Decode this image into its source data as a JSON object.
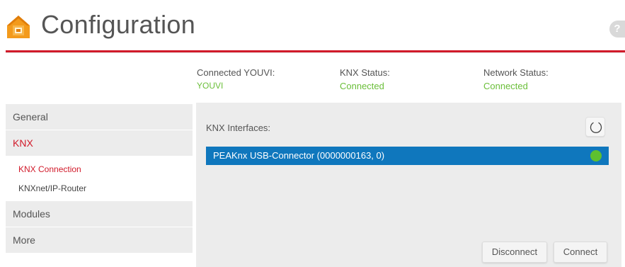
{
  "header": {
    "title": "Configuration",
    "help_label": "?",
    "accent_color": "#d11a2a",
    "logo_icon": "house-chip-icon"
  },
  "status": {
    "connected_youvi_label": "Connected YOUVI:",
    "connected_youvi_value": "YOUVI",
    "knx_status_label": "KNX Status:",
    "knx_status_value": "Connected",
    "network_status_label": "Network Status:",
    "network_status_value": "Connected",
    "ok_color": "#6bbf3a"
  },
  "sidebar": {
    "items": [
      {
        "label": "General"
      },
      {
        "label": "KNX",
        "active": true
      },
      {
        "label": "Modules"
      },
      {
        "label": "More"
      }
    ],
    "knx_sub": [
      {
        "label": "KNX Connection",
        "active": true
      },
      {
        "label": "KNXnet/IP-Router"
      }
    ]
  },
  "main": {
    "interfaces_label": "KNX Interfaces:",
    "refresh_icon": "refresh-icon",
    "interfaces": [
      {
        "name": "PEAKnx USB-Connector (0000000163, 0)",
        "status": "connected",
        "selected": true
      }
    ],
    "disconnect_label": "Disconnect",
    "connect_label": "Connect"
  }
}
